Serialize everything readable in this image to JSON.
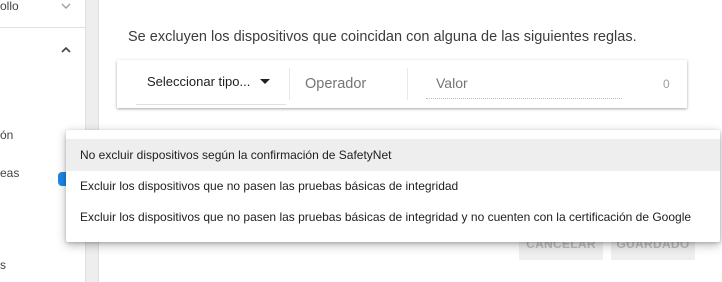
{
  "sidebar": {
    "items": [
      {
        "label": "ollo",
        "chevron": "down"
      },
      {
        "label": "",
        "chevron": "up"
      },
      {
        "label": "ón"
      },
      {
        "label": "eas"
      },
      {
        "label": "s"
      }
    ]
  },
  "rules": {
    "description": "Se excluyen los dispositivos que coincidan con alguna de las siguientes reglas.",
    "type_select": "Seleccionar tipo...",
    "operator_placeholder": "Operador",
    "value_placeholder": "Valor",
    "counter": "0"
  },
  "actions": {
    "cancel_label": "CANCELAR",
    "save_label": "GUARDADO"
  },
  "dropdown": {
    "options": [
      {
        "label": "No excluir dispositivos según la confirmación de SafetyNet",
        "selected": true
      },
      {
        "label": "Excluir los dispositivos que no pasen las pruebas básicas de integridad",
        "selected": false
      },
      {
        "label": "Excluir los dispositivos que no pasen las pruebas básicas de integridad y no cuenten con la certificación de Google",
        "selected": false
      }
    ]
  },
  "colors": {
    "accent": "#1e88e5",
    "selected_option_bg": "#eeeeee",
    "disabled_button_text": "#bdbdbd"
  }
}
